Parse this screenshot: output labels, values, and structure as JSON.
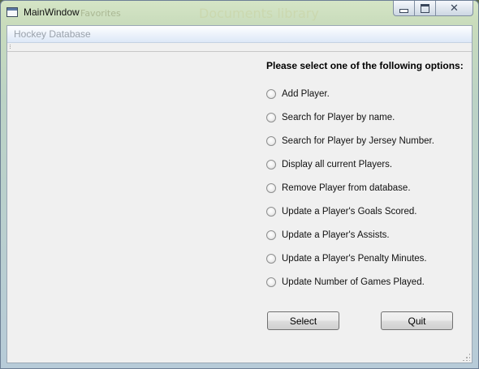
{
  "window": {
    "title": "MainWindow",
    "background_text_1": "Favorites",
    "background_text_2": "Documents library",
    "close_glyph": "✕"
  },
  "menubar": {
    "items": [
      {
        "label": "Hockey Database"
      }
    ]
  },
  "main": {
    "prompt": "Please select one of the following options:",
    "options": [
      {
        "label": "Add Player.",
        "selected": false
      },
      {
        "label": "Search for Player by name.",
        "selected": false
      },
      {
        "label": "Search for Player by Jersey Number.",
        "selected": false
      },
      {
        "label": "Display all current Players.",
        "selected": false
      },
      {
        "label": "Remove Player from database.",
        "selected": false
      },
      {
        "label": "Update a Player's Goals Scored.",
        "selected": false
      },
      {
        "label": "Update a Player's Assists.",
        "selected": false
      },
      {
        "label": "Update a Player's Penalty Minutes.",
        "selected": false
      },
      {
        "label": "Update Number of Games Played.",
        "selected": false
      }
    ],
    "select_label": "Select",
    "quit_label": "Quit"
  },
  "icons": {
    "app": "window-icon",
    "minimize": "minimize-icon",
    "maximize": "maximize-icon",
    "close": "close-icon",
    "radio": "radio-button-unchecked-icon",
    "grip": "size-grip-icon"
  }
}
